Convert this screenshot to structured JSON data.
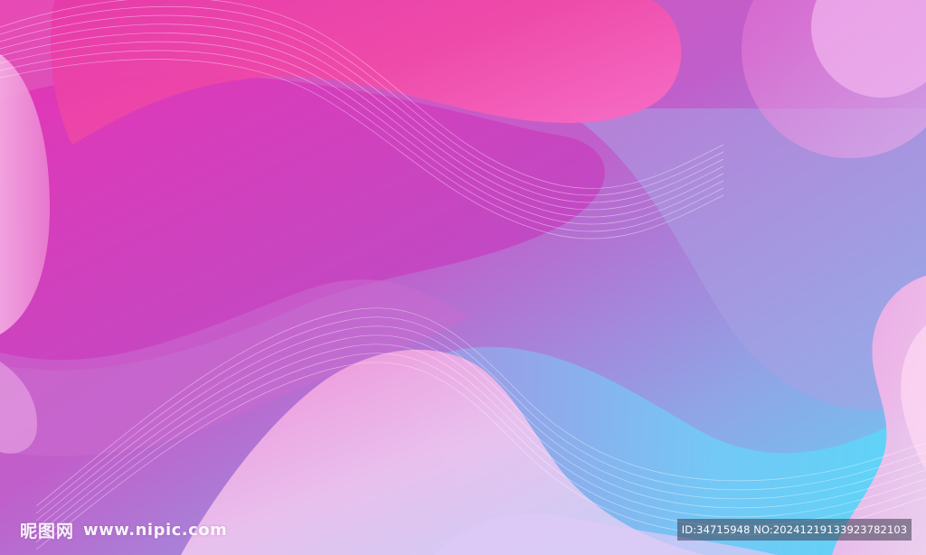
{
  "watermark": {
    "site_name": "昵图网",
    "site_url": "www.nipic.com"
  },
  "badge": {
    "text": "ID:34715948 NO:20241219133923782103"
  },
  "palette": {
    "magenta": "#e33fb5",
    "hot_pink": "#f24f9f",
    "violet": "#b565d0",
    "periwinkle": "#9aa6e6",
    "cyan": "#5fd4f7",
    "light_pink": "#f7b3e3"
  }
}
